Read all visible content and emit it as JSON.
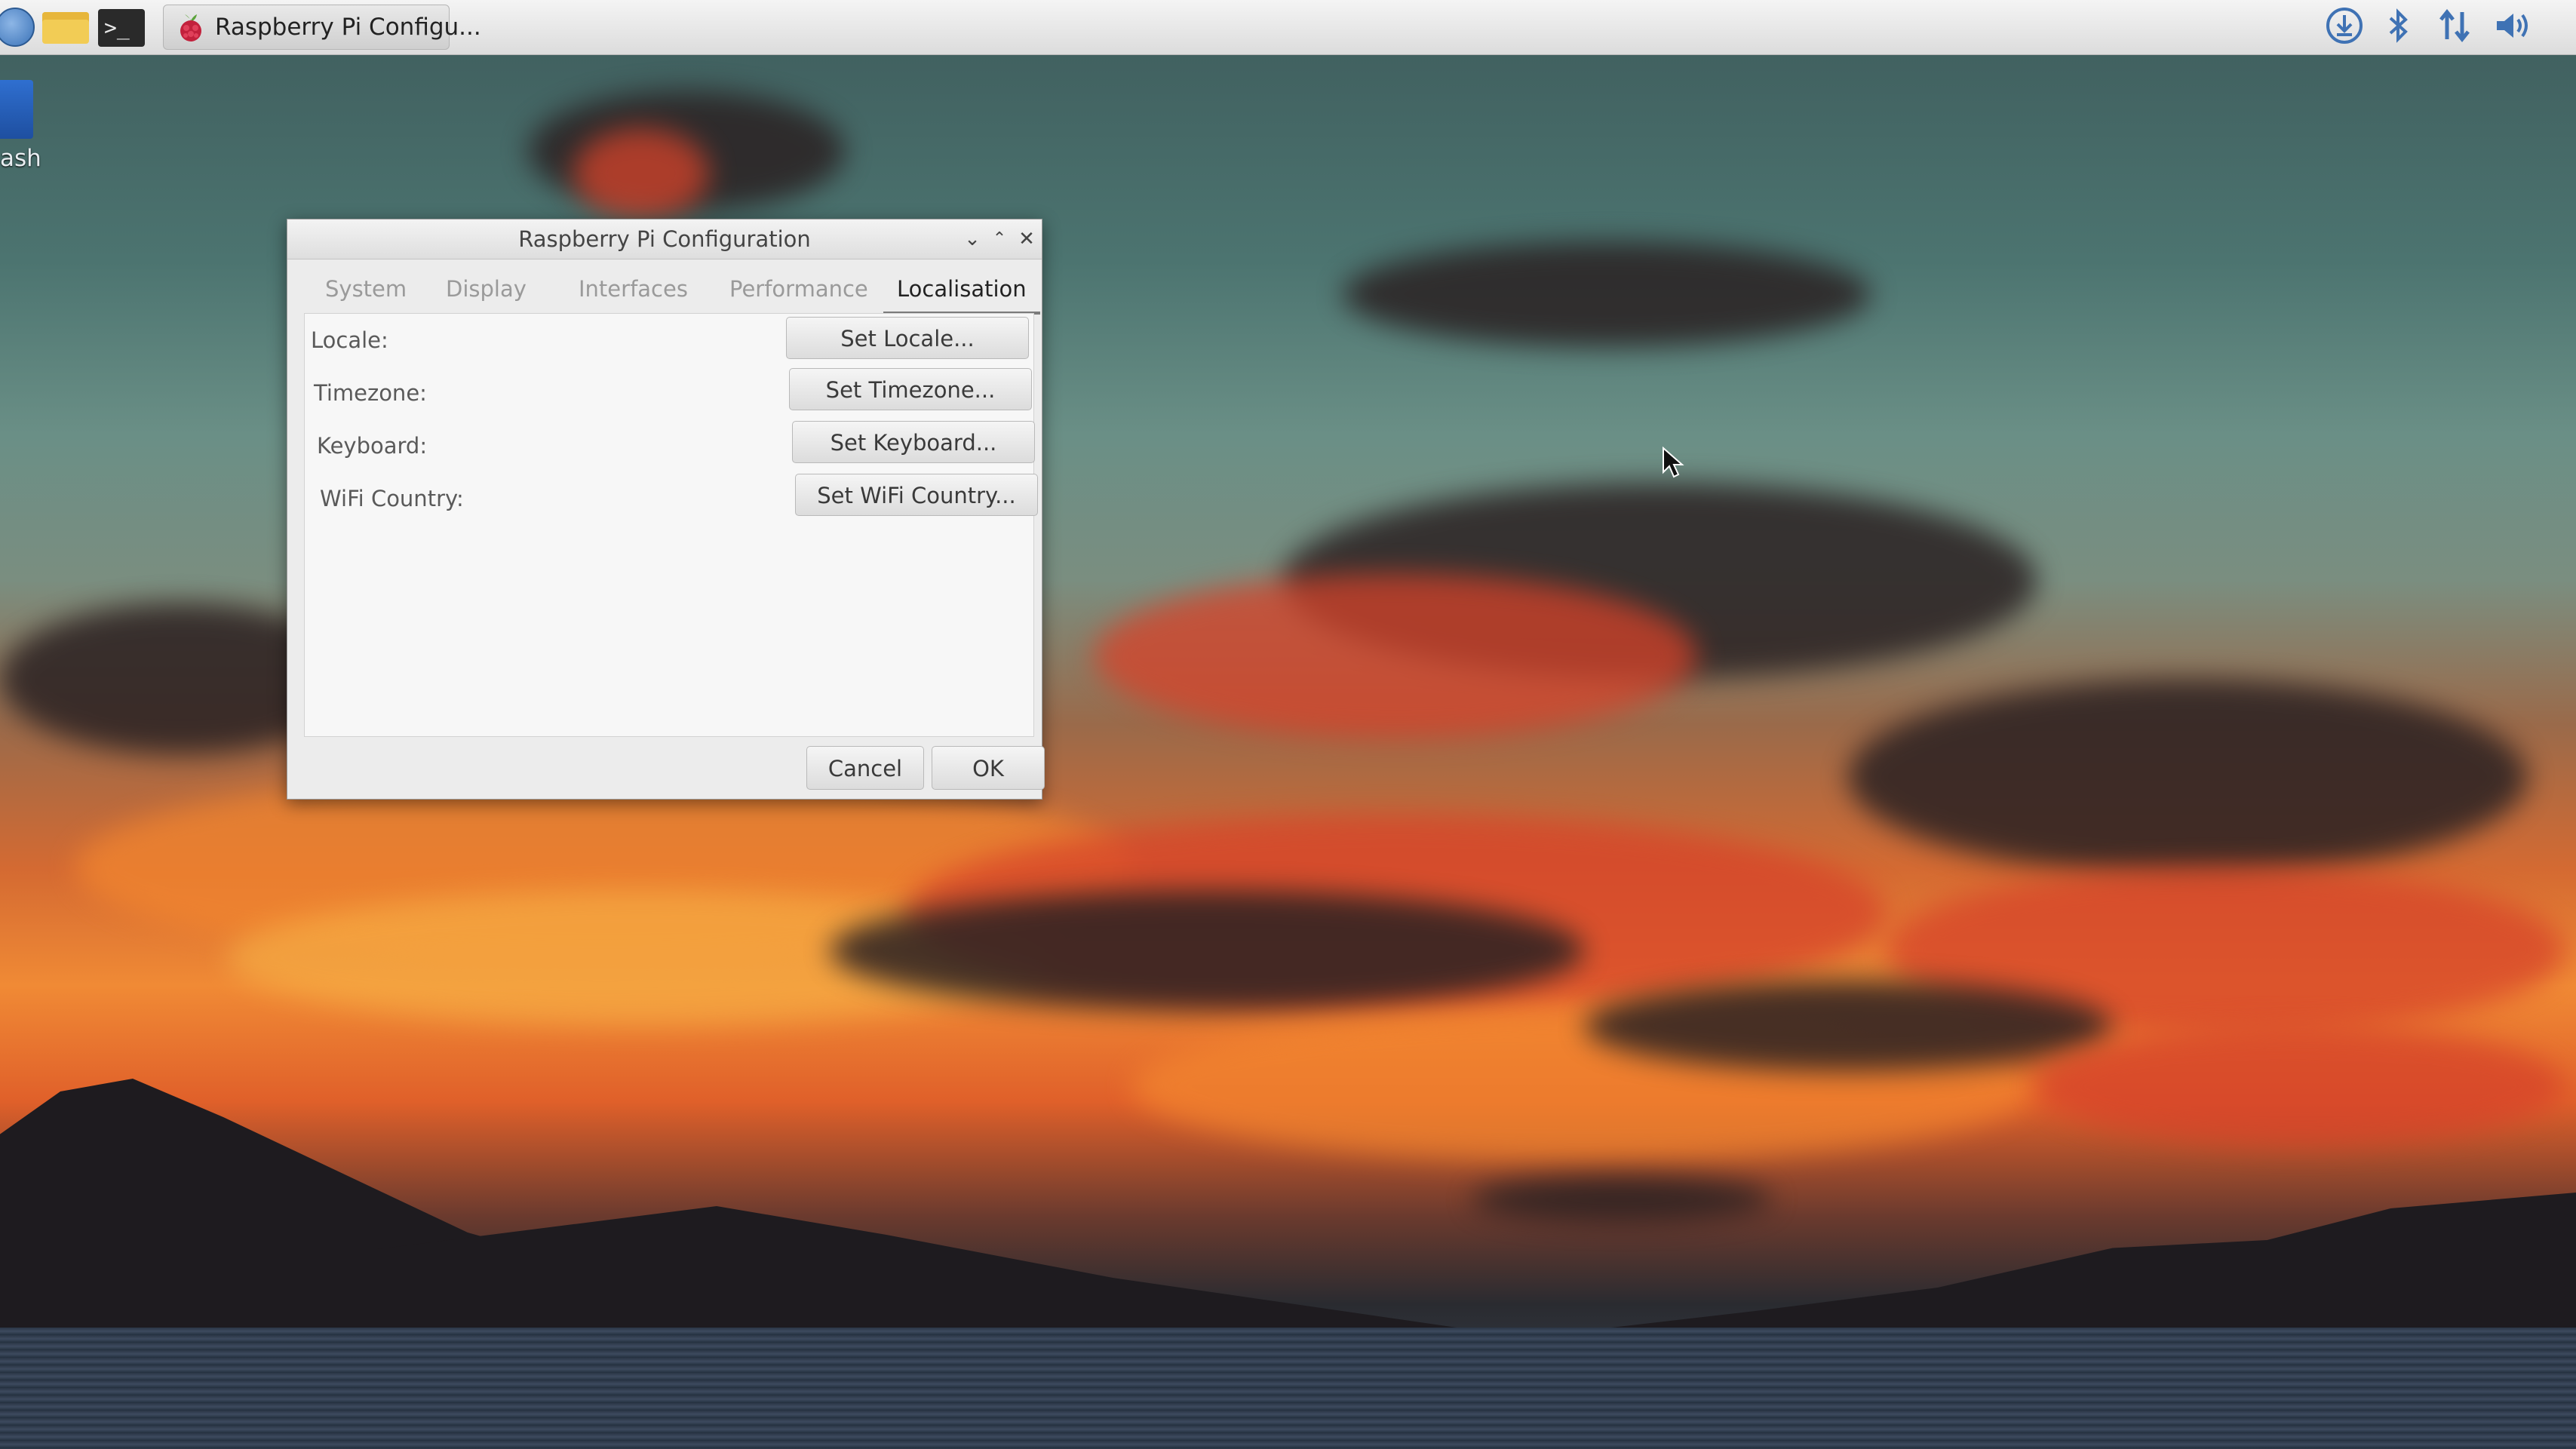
{
  "taskbar": {
    "task_title": "Raspberry Pi Configu...",
    "tray_icons": [
      "download-icon",
      "bluetooth-icon",
      "network-transfer-icon",
      "volume-icon"
    ]
  },
  "desktop": {
    "icon_label": "ash"
  },
  "dialog": {
    "title": "Raspberry Pi Configuration",
    "tabs": [
      {
        "label": "System"
      },
      {
        "label": "Display"
      },
      {
        "label": "Interfaces"
      },
      {
        "label": "Performance"
      },
      {
        "label": "Localisation",
        "active": true
      }
    ],
    "rows": [
      {
        "label": "Locale:",
        "button": "Set Locale..."
      },
      {
        "label": "Timezone:",
        "button": "Set Timezone..."
      },
      {
        "label": "Keyboard:",
        "button": "Set Keyboard..."
      },
      {
        "label": "WiFi Country:",
        "button": "Set WiFi Country..."
      }
    ],
    "cancel_label": "Cancel",
    "ok_label": "OK"
  },
  "colors": {
    "tray_blue": "#3f72b4",
    "dialog_bg": "#ececec"
  }
}
